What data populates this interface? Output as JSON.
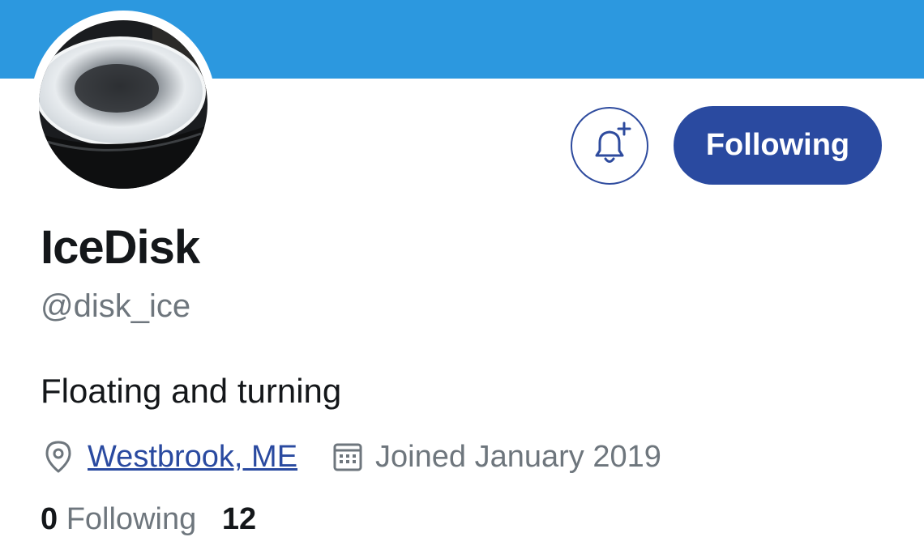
{
  "profile": {
    "name": "IceDisk",
    "handle": "@disk_ice",
    "bio": "Floating and turning",
    "location": "Westbrook, ME",
    "joined": "Joined January 2019"
  },
  "actions": {
    "follow_label": "Following",
    "notify_icon": "bell-plus-icon"
  },
  "stats": {
    "following_count": "0",
    "following_label": "Following",
    "followers_count": "12"
  },
  "colors": {
    "banner": "#2c98df",
    "accent": "#2a4aa0",
    "secondary_text": "#6e767d"
  }
}
